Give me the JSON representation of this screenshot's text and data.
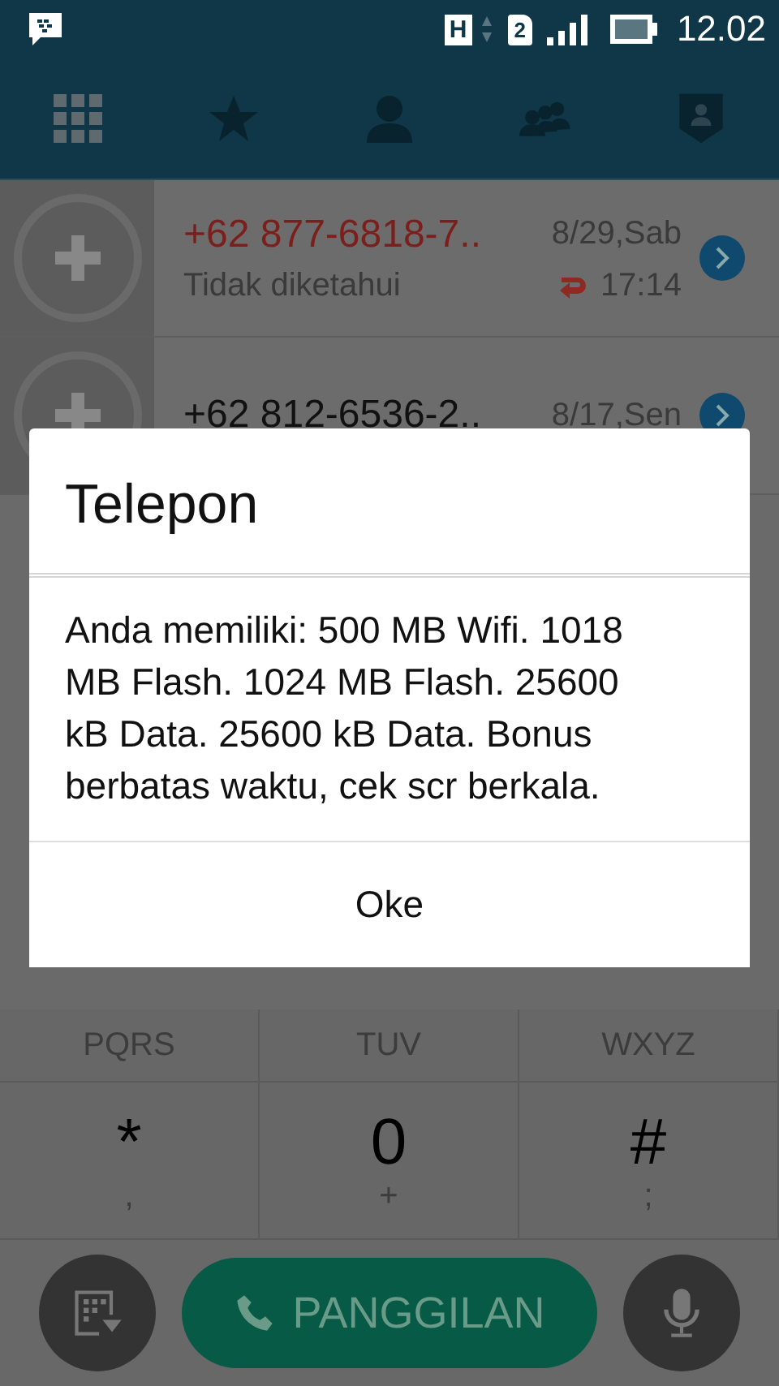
{
  "status_bar": {
    "network": "H",
    "sim": "2",
    "time": "12.02"
  },
  "tabs": [
    {
      "kind": "dialpad",
      "selected": true
    },
    {
      "kind": "favorites",
      "selected": false
    },
    {
      "kind": "contact",
      "selected": false
    },
    {
      "kind": "groups",
      "selected": false
    },
    {
      "kind": "profile",
      "selected": false
    }
  ],
  "calls": [
    {
      "number": "+62 877-6818-7..",
      "date": "8/29,Sab",
      "status": "Tidak diketahui",
      "time": "17:14",
      "missed": true
    },
    {
      "number": "+62 812-6536-2..",
      "date": "8/17,Sen",
      "missed": false
    }
  ],
  "keypad": [
    {
      "letters": "PQRS"
    },
    {
      "letters": "TUV"
    },
    {
      "letters": "WXYZ"
    },
    {
      "digit": "*",
      "letters": ","
    },
    {
      "digit": "0",
      "letters": "+"
    },
    {
      "digit": "#",
      "letters": ";"
    }
  ],
  "call_button": "PANGGILAN",
  "dialog": {
    "title": "Telepon",
    "message": "Anda memiliki: 500 MB Wifi. 1018 MB Flash. 1024 MB Flash. 25600 kB Data. 25600 kB Data. Bonus berbatas waktu, cek scr berkala.",
    "button": "Oke"
  }
}
